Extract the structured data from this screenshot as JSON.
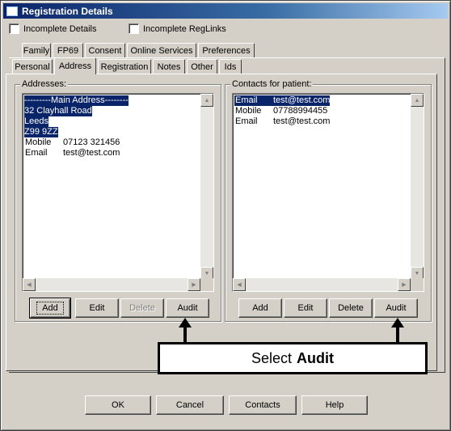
{
  "window": {
    "title": "Registration Details"
  },
  "checks": {
    "incomplete_details": "Incomplete Details",
    "incomplete_reglinks": "Incomplete RegLinks"
  },
  "tabs_back": [
    "Family",
    "FP69",
    "Consent",
    "Online Services",
    "Preferences"
  ],
  "tabs_front": [
    "Personal",
    "Address",
    "Registration",
    "Notes",
    "Other",
    "Ids"
  ],
  "active_tab": "Address",
  "addresses": {
    "label": "Addresses:",
    "rows": [
      {
        "c1": "---------Main Address--------",
        "c2": "",
        "selected": true
      },
      {
        "c1": "32 Clayhall Road",
        "c2": "",
        "selected": true
      },
      {
        "c1": "Leeds",
        "c2": "",
        "selected": true
      },
      {
        "c1": "Z99 9ZZ",
        "c2": "",
        "selected": true
      },
      {
        "c1": "Mobile",
        "c2": "07123 321456",
        "selected": false
      },
      {
        "c1": "Email",
        "c2": "test@test.com",
        "selected": false
      }
    ],
    "buttons": {
      "add": "Add",
      "edit": "Edit",
      "delete": "Delete",
      "audit": "Audit"
    }
  },
  "contacts": {
    "label": "Contacts for patient:",
    "rows": [
      {
        "c1": "Email",
        "c2": "test@test.com",
        "selected": true
      },
      {
        "c1": "Mobile",
        "c2": "07788994455",
        "selected": false
      },
      {
        "c1": "Email",
        "c2": "test@test.com",
        "selected": false
      }
    ],
    "buttons": {
      "add": "Add",
      "edit": "Edit",
      "delete": "Delete",
      "audit": "Audit"
    }
  },
  "callout": {
    "prefix": "Select",
    "bold": "Audit"
  },
  "footer": {
    "ok": "OK",
    "cancel": "Cancel",
    "contacts": "Contacts",
    "help": "Help"
  },
  "colors": {
    "titlebar": "#0a246a",
    "selection": "#0a246a",
    "face": "#d4d0c8"
  }
}
